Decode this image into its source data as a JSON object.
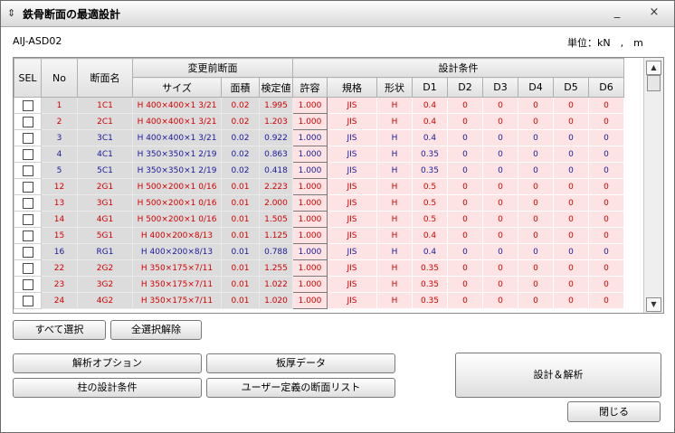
{
  "window": {
    "title": "鉄骨断面の最適設計",
    "minimize": "_",
    "close": "×"
  },
  "header": {
    "app_id": "AIJ-ASD02",
    "unit": "単位：kN　,　m"
  },
  "table": {
    "group_headers": {
      "before": "変更前断面",
      "design": "設計条件"
    },
    "columns": {
      "sel": "SEL",
      "no": "No",
      "name": "断面名",
      "size": "サイズ",
      "area": "面積",
      "check": "検定値",
      "allow": "許容",
      "std": "規格",
      "shape": "形状",
      "d1": "D1",
      "d2": "D2",
      "d3": "D3",
      "d4": "D4",
      "d5": "D5",
      "d6": "D6"
    },
    "rows": [
      {
        "no": "1",
        "name": "1C1",
        "size": "H 400×400×1 3/21",
        "area": "0.02",
        "check": "1.995",
        "allow": "1.000",
        "std": "JIS",
        "shape": "H",
        "d1": "0.4",
        "d2": "0",
        "d3": "0",
        "d4": "0",
        "d5": "0",
        "d6": "0",
        "color": "red"
      },
      {
        "no": "2",
        "name": "2C1",
        "size": "H 400×400×1 3/21",
        "area": "0.02",
        "check": "1.203",
        "allow": "1.000",
        "std": "JIS",
        "shape": "H",
        "d1": "0.4",
        "d2": "0",
        "d3": "0",
        "d4": "0",
        "d5": "0",
        "d6": "0",
        "color": "red"
      },
      {
        "no": "3",
        "name": "3C1",
        "size": "H 400×400×1 3/21",
        "area": "0.02",
        "check": "0.922",
        "allow": "1.000",
        "std": "JIS",
        "shape": "H",
        "d1": "0.4",
        "d2": "0",
        "d3": "0",
        "d4": "0",
        "d5": "0",
        "d6": "0",
        "color": "blue"
      },
      {
        "no": "4",
        "name": "4C1",
        "size": "H 350×350×1 2/19",
        "area": "0.02",
        "check": "0.863",
        "allow": "1.000",
        "std": "JIS",
        "shape": "H",
        "d1": "0.35",
        "d2": "0",
        "d3": "0",
        "d4": "0",
        "d5": "0",
        "d6": "0",
        "color": "blue"
      },
      {
        "no": "5",
        "name": "5C1",
        "size": "H 350×350×1 2/19",
        "area": "0.02",
        "check": "0.418",
        "allow": "1.000",
        "std": "JIS",
        "shape": "H",
        "d1": "0.35",
        "d2": "0",
        "d3": "0",
        "d4": "0",
        "d5": "0",
        "d6": "0",
        "color": "blue"
      },
      {
        "no": "12",
        "name": "2G1",
        "size": "H 500×200×1 0/16",
        "area": "0.01",
        "check": "2.223",
        "allow": "1.000",
        "std": "JIS",
        "shape": "H",
        "d1": "0.5",
        "d2": "0",
        "d3": "0",
        "d4": "0",
        "d5": "0",
        "d6": "0",
        "color": "red"
      },
      {
        "no": "13",
        "name": "3G1",
        "size": "H 500×200×1 0/16",
        "area": "0.01",
        "check": "2.000",
        "allow": "1.000",
        "std": "JIS",
        "shape": "H",
        "d1": "0.5",
        "d2": "0",
        "d3": "0",
        "d4": "0",
        "d5": "0",
        "d6": "0",
        "color": "red"
      },
      {
        "no": "14",
        "name": "4G1",
        "size": "H 500×200×1 0/16",
        "area": "0.01",
        "check": "1.505",
        "allow": "1.000",
        "std": "JIS",
        "shape": "H",
        "d1": "0.5",
        "d2": "0",
        "d3": "0",
        "d4": "0",
        "d5": "0",
        "d6": "0",
        "color": "red"
      },
      {
        "no": "15",
        "name": "5G1",
        "size": "H 400×200×8/13",
        "area": "0.01",
        "check": "1.125",
        "allow": "1.000",
        "std": "JIS",
        "shape": "H",
        "d1": "0.4",
        "d2": "0",
        "d3": "0",
        "d4": "0",
        "d5": "0",
        "d6": "0",
        "color": "red"
      },
      {
        "no": "16",
        "name": "RG1",
        "size": "H 400×200×8/13",
        "area": "0.01",
        "check": "0.788",
        "allow": "1.000",
        "std": "JIS",
        "shape": "H",
        "d1": "0.4",
        "d2": "0",
        "d3": "0",
        "d4": "0",
        "d5": "0",
        "d6": "0",
        "color": "blue"
      },
      {
        "no": "22",
        "name": "2G2",
        "size": "H 350×175×7/11",
        "area": "0.01",
        "check": "1.255",
        "allow": "1.000",
        "std": "JIS",
        "shape": "H",
        "d1": "0.35",
        "d2": "0",
        "d3": "0",
        "d4": "0",
        "d5": "0",
        "d6": "0",
        "color": "red"
      },
      {
        "no": "23",
        "name": "3G2",
        "size": "H 350×175×7/11",
        "area": "0.01",
        "check": "1.022",
        "allow": "1.000",
        "std": "JIS",
        "shape": "H",
        "d1": "0.35",
        "d2": "0",
        "d3": "0",
        "d4": "0",
        "d5": "0",
        "d6": "0",
        "color": "red"
      },
      {
        "no": "24",
        "name": "4G2",
        "size": "H 350×175×7/11",
        "area": "0.01",
        "check": "1.020",
        "allow": "1.000",
        "std": "JIS",
        "shape": "H",
        "d1": "0.35",
        "d2": "0",
        "d3": "0",
        "d4": "0",
        "d5": "0",
        "d6": "0",
        "color": "red"
      }
    ]
  },
  "buttons": {
    "select_all": "すべて選択",
    "deselect_all": "全選択解除",
    "analysis_options": "解析オプション",
    "plate_data": "板厚データ",
    "column_design": "柱の設計条件",
    "user_sections": "ユーザー定義の断面リスト",
    "design_analyze": "設計＆解析",
    "close": "閉じる"
  },
  "colors": {
    "fail_text": "#d40000",
    "ok_text": "#1a1a9a",
    "condition_bg": "#fde3e3",
    "fixed_bg": "#dcdcdc"
  }
}
